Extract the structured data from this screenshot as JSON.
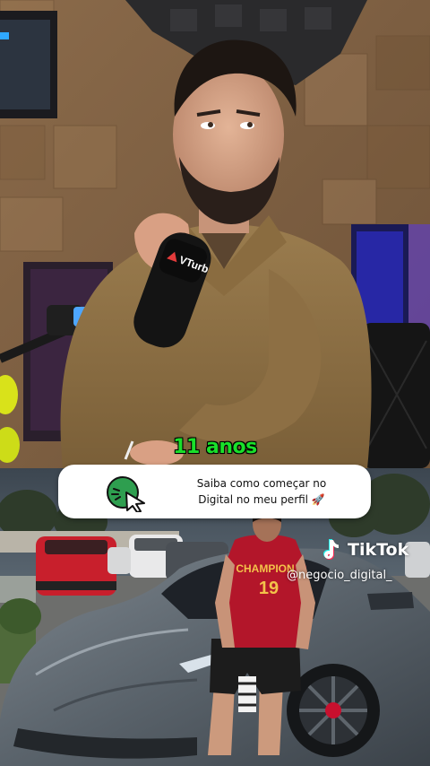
{
  "video": {
    "mic_brand": "VTurb",
    "jersey_text": "CHAMPION",
    "jersey_number": "19"
  },
  "caption": {
    "text": "11 anos",
    "color": "#19e02a"
  },
  "cta": {
    "line1": "Saiba como começar no",
    "line2": "Digital no meu perfil 🚀",
    "icon": "cursor-click-icon",
    "accent_color": "#2e9e4f"
  },
  "watermark": {
    "brand": "TikTok",
    "handle": "@negocio_digital_",
    "icon": "tiktok-logo-icon"
  }
}
